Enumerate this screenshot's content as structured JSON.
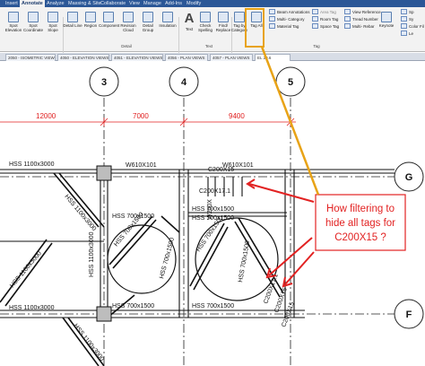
{
  "ribbon": {
    "tabs": [
      "Insert",
      "Annotate",
      "Analyze",
      "Massing & Site",
      "Collaborate",
      "View",
      "Manage",
      "Add-Ins",
      "Modify"
    ],
    "active_tab": "Annotate",
    "buttons": {
      "spot_elevation": "Spot Elevation",
      "spot_coordinate": "Spot Coordinate",
      "spot_slope": "Spot Slope",
      "detail_line": "Detail Line",
      "region": "Region",
      "component": "Component",
      "revision_cloud": "Revision Cloud",
      "detail_group": "Detail Group",
      "insulation": "Insulation",
      "text": "Text",
      "check_spelling": "Check Spelling",
      "find_replace": "Find/ Replace",
      "tag_by_category": "Tag by Category",
      "tag_all": "Tag All",
      "keynote": "Keynote"
    },
    "small_items": {
      "beam_annotations": "Beam Annotations",
      "multi_category": "Multi- Category",
      "material_tag": "Material Tag",
      "area_tag": "Area Tag",
      "room_tag": "Room Tag",
      "space_tag": "Space Tag",
      "view_reference": "View Reference",
      "tread_number": "Tread Number",
      "multi_rebar": "Multi- Rebar",
      "span_label": "Sp",
      "sym_label": "Sy",
      "color_fill": "Color Fil",
      "legend": "Le"
    },
    "groups": {
      "detail": "Detail",
      "text": "Text",
      "tag": "Tag"
    }
  },
  "view_tabs": [
    "2050 - ISOMETRIC VIEW",
    "4050 - ELEVATION VIEWS",
    "4051 - ELEVATION VIEWS",
    "4056 - PLAN VIEWS",
    "4057 - PLAN VIEWS",
    "EL 29.6"
  ],
  "drawing": {
    "grid_bubbles": [
      "3",
      "4",
      "5",
      "G",
      "F"
    ],
    "dimensions": [
      "12000",
      "7000",
      "9400"
    ],
    "labels": {
      "hss_top": "HSS 1100x3000",
      "hss_bottom": "HSS 1100x3000",
      "w_beam_top": "W610X101",
      "w_beam_right": "W610X101",
      "c_tag_top": "C200X15",
      "c_tag_mid": "C200X17.1",
      "hss_700_1": "HSS 700x1500",
      "hss_700_2": "HSS 700x1500",
      "hss_700_3": "HSS 700x1500",
      "hss_700_4": "HSS 700x1500",
      "hss_700_5": "HSS 700x1500",
      "hss_700_6": "HSS 700x1500",
      "hss_700_7": "HSS 700x1500",
      "hss_700_8": "HSS 700x1500",
      "hss_700_9": "HSS 700x1500",
      "hss_1100_v": "HSS 1100x3000",
      "hss_1100_diag1": "HSS 1100x3000",
      "hss_1100_diag2": "HSS 1100x3000",
      "hss_1100_diag3": "HSS 1100x3000",
      "w200": "W200X",
      "c200_b1": "C200X17.1",
      "c200_b2": "C200X15",
      "c200_b3": "C200X15"
    }
  },
  "callout": {
    "lines": [
      "How filtering to",
      "hide all tags for",
      "C200X15 ?"
    ],
    "color": "#e22222"
  },
  "colors": {
    "ribbon_blue": "#2b5797",
    "highlight": "#e8a317",
    "dimension_red": "#e02020"
  }
}
